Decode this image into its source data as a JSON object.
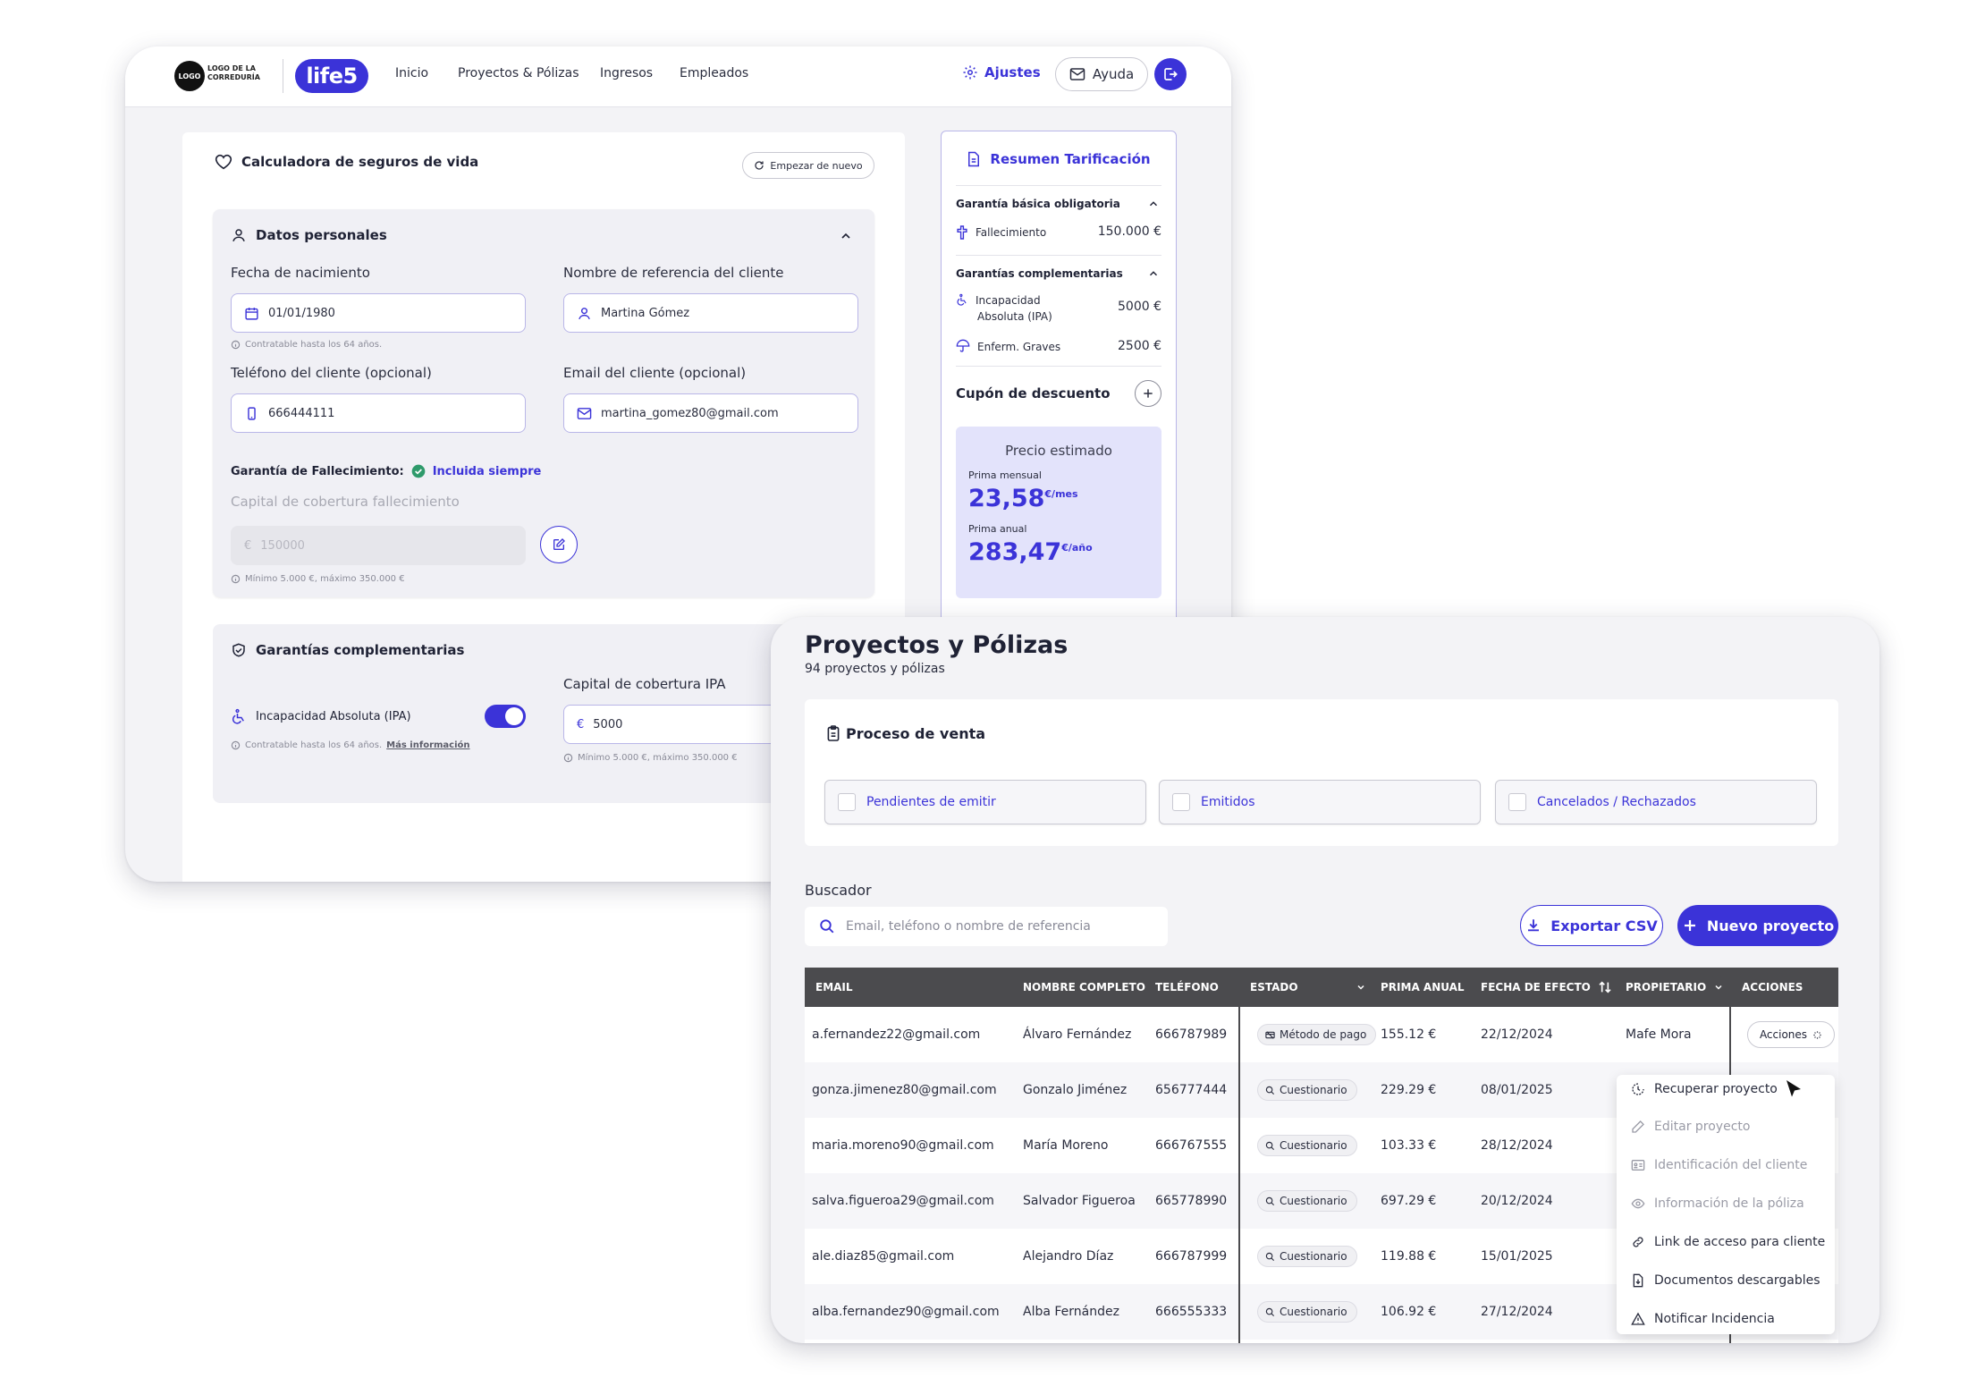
{
  "calculator_window": {
    "logo": {
      "badge": "LOGO",
      "text": "LOGO DE LA CORREDURÍA"
    },
    "brand": "life5",
    "nav": [
      "Inicio",
      "Proyectos & Pólizas",
      "Ingresos",
      "Empleados"
    ],
    "settings_label": "Ajustes",
    "help_label": "Ayuda",
    "title": "Calculadora de seguros de vida",
    "restart_label": "Empezar de nuevo",
    "personal": {
      "heading": "Datos personales",
      "birth_label": "Fecha de nacimiento",
      "birth_value": "01/01/1980",
      "birth_hint": "Contratable hasta los 64 años.",
      "ref_label": "Nombre de referencia del cliente",
      "ref_value": "Martina Gómez",
      "phone_label": "Teléfono del cliente (opcional)",
      "phone_value": "666444111",
      "email_label": "Email del cliente (opcional)",
      "email_value": "martina_gomez80@gmail.com",
      "death_guarantee_label": "Garantía de Fallecimiento:",
      "death_guarantee_status": "Incluida siempre",
      "capital_label": "Capital de cobertura fallecimiento",
      "capital_currency": "€",
      "capital_value": "150000",
      "capital_hint": "Mínimo 5.000 €, máximo 350.000 €"
    },
    "complementary": {
      "heading": "Garantías complementarias",
      "ipa_label": "Incapacidad Absoluta (IPA)",
      "ipa_enabled": true,
      "ipa_hint": "Contratable hasta los 64 años.",
      "ipa_hint_link": "Más información",
      "capital_label": "Capital de cobertura IPA",
      "capital_currency": "€",
      "capital_value": "5000",
      "capital_hint": "Mínimo 5.000 €, máximo 350.000 €"
    },
    "summary": {
      "title": "Resumen Tarificación",
      "basic_heading": "Garantía básica obligatoria",
      "death_label": "Fallecimiento",
      "death_value": "150.000 €",
      "comp_heading": "Garantías complementarias",
      "ipa_label_1": "Incapacidad",
      "ipa_label_2": "Absoluta (IPA)",
      "ipa_value": "5000 €",
      "grave_label": "Enferm. Graves",
      "grave_value": "2500 €",
      "coupon_label": "Cupón de descuento",
      "price_title": "Precio estimado",
      "monthly_label": "Prima mensual",
      "monthly_value": "23,58",
      "monthly_unit": "€/mes",
      "annual_label": "Prima anual",
      "annual_value": "283,47",
      "annual_unit": "€/año"
    }
  },
  "projects_window": {
    "title": "Proyectos y Pólizas",
    "subtitle": "94 proyectos y pólizas",
    "process_title": "Proceso de venta",
    "filters": [
      "Pendientes de emitir",
      "Emitidos",
      "Cancelados / Rechazados"
    ],
    "search_label": "Buscador",
    "search_placeholder": "Email, teléfono o nombre de referencia",
    "export_label": "Exportar CSV",
    "new_label": "Nuevo proyecto",
    "columns": [
      "EMAIL",
      "NOMBRE COMPLETO",
      "TELÉFONO",
      "ESTADO",
      "PRIMA ANUAL",
      "FECHA DE EFECTO",
      "PROPIETARIO",
      "ACCIONES"
    ],
    "rows": [
      {
        "email": "a.fernandez22@gmail.com",
        "name": "Álvaro Fernández",
        "phone": "666787989",
        "status": "Método de pago",
        "premium": "155.12 €",
        "date": "22/12/2024",
        "owner": "Mafe Mora"
      },
      {
        "email": "gonza.jimenez80@gmail.com",
        "name": "Gonzalo Jiménez",
        "phone": "656777444",
        "status": "Cuestionario",
        "premium": "229.29 €",
        "date": "08/01/2025",
        "owner": ""
      },
      {
        "email": "maria.moreno90@gmail.com",
        "name": "María Moreno",
        "phone": "666767555",
        "status": "Cuestionario",
        "premium": "103.33 €",
        "date": "28/12/2024",
        "owner": ""
      },
      {
        "email": "salva.figueroa29@gmail.com",
        "name": "Salvador Figueroa",
        "phone": "665778990",
        "status": "Cuestionario",
        "premium": "697.29 €",
        "date": "20/12/2024",
        "owner": ""
      },
      {
        "email": "ale.diaz85@gmail.com",
        "name": "Alejandro Díaz",
        "phone": "666787999",
        "status": "Cuestionario",
        "premium": "119.88 €",
        "date": "15/01/2025",
        "owner": ""
      },
      {
        "email": "alba.fernandez90@gmail.com",
        "name": "Alba Fernández",
        "phone": "666555333",
        "status": "Cuestionario",
        "premium": "106.92 €",
        "date": "27/12/2024",
        "owner": ""
      }
    ],
    "actions_label": "Acciones",
    "menu": [
      {
        "label": "Recuperar proyecto",
        "icon": "recover-icon"
      },
      {
        "label": "Editar proyecto",
        "icon": "pencil-icon"
      },
      {
        "label": "Identificación del cliente",
        "icon": "id-card-icon"
      },
      {
        "label": "Información de la póliza",
        "icon": "eye-icon"
      },
      {
        "label": "Link de acceso para cliente",
        "icon": "link-icon"
      },
      {
        "label": "Documentos descargables",
        "icon": "document-download-icon"
      },
      {
        "label": "Notificar Incidencia",
        "icon": "warning-icon"
      }
    ]
  },
  "colors": {
    "accent": "#3b33d8",
    "accent_soft": "#e3e3fb",
    "header_dark": "#4b4b4e",
    "success": "#2e9a6b"
  }
}
